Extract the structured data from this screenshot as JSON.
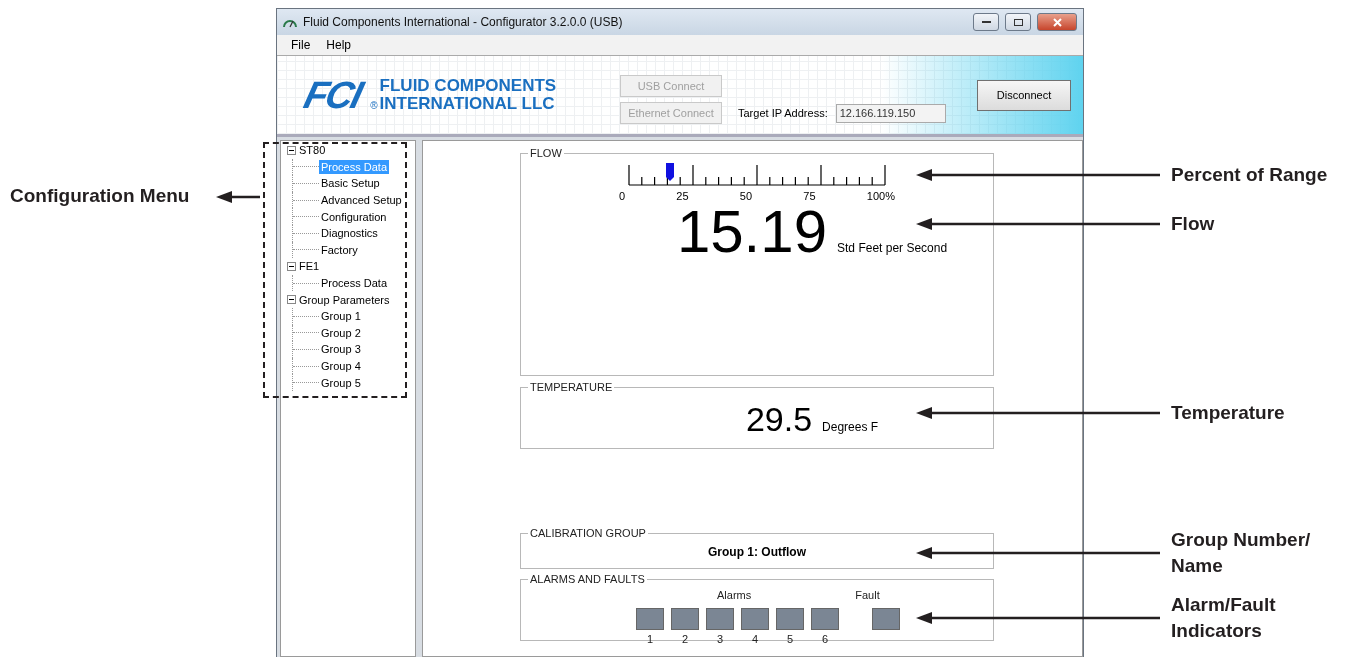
{
  "window": {
    "title": "Fluid Components International - Configurator 3.2.0.0 (USB)"
  },
  "menu": [
    "File",
    "Help"
  ],
  "header": {
    "logo_mark": "FCI",
    "logo_registered": "®",
    "logo_lines": [
      "FLUID COMPONENTS",
      "INTERNATIONAL LLC"
    ],
    "buttons": [
      {
        "label": "USB Connect",
        "disabled": true
      },
      {
        "label": "Ethernet Connect",
        "disabled": true
      }
    ],
    "ip": {
      "label": "Target IP Address:",
      "value": "12.166.119.150"
    },
    "disconnect": {
      "label": "Disconnect",
      "disabled": false
    }
  },
  "tree": [
    {
      "label": "ST80",
      "expanded": true,
      "children": [
        {
          "label": "Process Data",
          "selected": true
        },
        {
          "label": "Basic Setup",
          "selected": false
        },
        {
          "label": "Advanced Setup",
          "selected": false
        },
        {
          "label": "Configuration",
          "selected": false
        },
        {
          "label": "Diagnostics",
          "selected": false
        },
        {
          "label": "Factory",
          "selected": false
        }
      ]
    },
    {
      "label": "FE1",
      "expanded": true,
      "children": [
        {
          "label": "Process Data",
          "selected": false
        }
      ]
    },
    {
      "label": "Group Parameters",
      "expanded": true,
      "children": [
        {
          "label": "Group 1",
          "selected": false
        },
        {
          "label": "Group 2",
          "selected": false
        },
        {
          "label": "Group 3",
          "selected": false
        },
        {
          "label": "Group 4",
          "selected": false
        },
        {
          "label": "Group 5",
          "selected": false
        }
      ]
    }
  ],
  "flow": {
    "title": "FLOW",
    "gauge": {
      "level": 0.16,
      "ticks": [
        "0",
        "25",
        "50",
        "75",
        "100%"
      ]
    },
    "value": "15.19",
    "unit": "Std Feet per Second"
  },
  "temperature": {
    "title": "TEMPERATURE",
    "value": "29.5",
    "unit": "Degrees F"
  },
  "calibration": {
    "title": "CALIBRATION GROUP",
    "value": "Group 1: Outflow"
  },
  "alarms": {
    "title": "ALARMS AND FAULTS",
    "alarms_label": "Alarms",
    "fault_label": "Fault",
    "alarms": [
      {
        "label": "1",
        "active": false
      },
      {
        "label": "2",
        "active": false
      },
      {
        "label": "3",
        "active": false
      },
      {
        "label": "4",
        "active": false
      },
      {
        "label": "5",
        "active": false
      },
      {
        "label": "6",
        "active": false
      }
    ],
    "fault": {
      "active": false
    }
  },
  "callouts": {
    "left": [
      "Configuration Menu"
    ],
    "right": [
      {
        "lines": [
          "Percent of Range"
        ]
      },
      {
        "lines": [
          "Flow"
        ]
      },
      {
        "lines": [
          "Temperature"
        ]
      },
      {
        "lines": [
          "Group Number/",
          "Name"
        ]
      },
      {
        "lines": [
          "Alarm/Fault",
          "Indicators"
        ]
      }
    ]
  }
}
